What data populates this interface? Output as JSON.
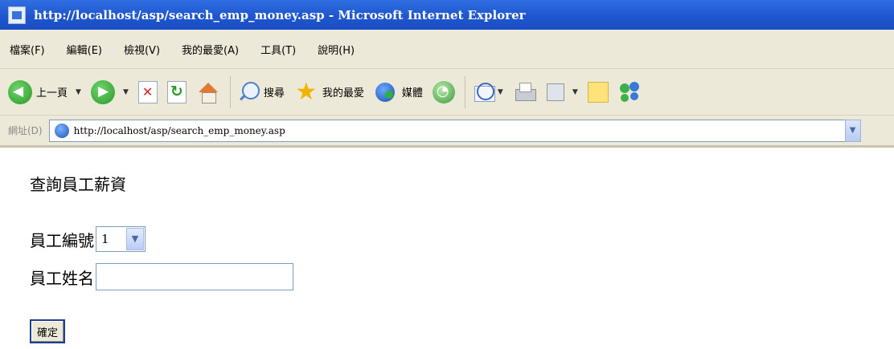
{
  "window": {
    "title": "http://localhost/asp/search_emp_money.asp - Microsoft Internet Explorer"
  },
  "menu": {
    "items": [
      "檔案(F)",
      "編輯(E)",
      "檢視(V)",
      "我的最愛(A)",
      "工具(T)",
      "說明(H)"
    ]
  },
  "toolbar": {
    "back_label": "上一頁",
    "search_label": "搜尋",
    "favorites_label": "我的最愛",
    "media_label": "媒體"
  },
  "address": {
    "label": "網址(D)",
    "url": "http://localhost/asp/search_emp_money.asp"
  },
  "page": {
    "title": "查詢員工薪資",
    "employee_id_label": "員工編號",
    "employee_id_value": "1",
    "employee_name_label": "員工姓名",
    "employee_name_value": "",
    "submit_label": "確定"
  }
}
